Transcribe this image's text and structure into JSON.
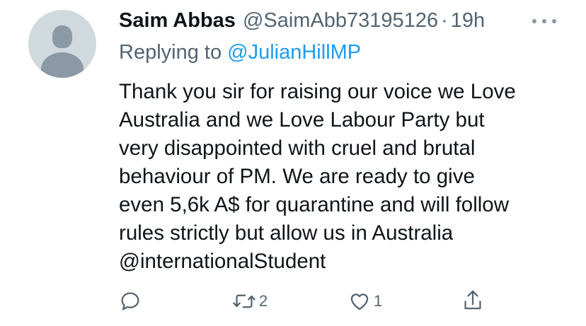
{
  "tweet": {
    "display_name": "Saim Abbas",
    "handle": "@SaimAbb73195126",
    "separator": "·",
    "time": "19h",
    "reply_prefix": "Replying to",
    "reply_mention": "@JulianHillMP",
    "body_lines": [
      "Thank you sir for raising our voice we Love",
      "Australia and we Love Labour Party but",
      "very disappointed with cruel and brutal",
      "behaviour of PM. We are ready to give",
      "even 5,6k A$ for quarantine and will follow",
      "rules strictly but allow us in Australia",
      "@internationalStudent"
    ]
  },
  "actions": {
    "reply": {
      "icon": "reply-icon"
    },
    "retweet": {
      "icon": "retweet-icon",
      "count": "2"
    },
    "like": {
      "icon": "heart-icon",
      "count": "1"
    },
    "share": {
      "icon": "share-icon"
    }
  },
  "colors": {
    "text": "#0f1419",
    "secondary": "#536471",
    "link": "#1d9bf0",
    "avatar_bg": "#cfd9de",
    "avatar_fg": "#8b98a5"
  }
}
